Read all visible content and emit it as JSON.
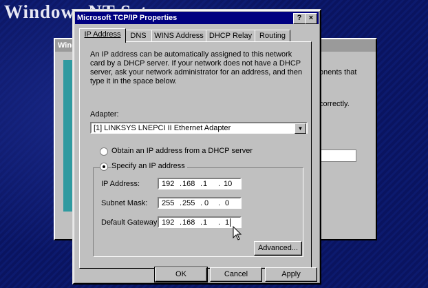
{
  "desktop": {
    "setup_title": "Windows NT Setup"
  },
  "background_window": {
    "title": "Windo",
    "text_components": "onents that",
    "text_correctly": "correctly."
  },
  "dialog": {
    "title": "Microsoft TCP/IP Properties",
    "help_button": "?",
    "close_button": "×",
    "tabs": [
      {
        "label": "IP Address",
        "active": true
      },
      {
        "label": "DNS",
        "active": false
      },
      {
        "label": "WINS Address",
        "active": false
      },
      {
        "label": "DHCP Relay",
        "active": false
      },
      {
        "label": "Routing",
        "active": false
      }
    ],
    "intro_text": "An IP address can be automatically assigned to this network card by a DHCP server.  If your network does not have a DHCP server, ask your network administrator for an address, and then type it in the space below.",
    "adapter_label": "Adapter:",
    "adapter_value": "[1] LINKSYS LNEPCI II Ethernet Adapter",
    "radio_dhcp": {
      "label": "Obtain an IP address from a DHCP server",
      "selected": false
    },
    "radio_specify": {
      "label": "Specify an IP address",
      "selected": true
    },
    "ip_address": {
      "label": "IP Address:",
      "octets": [
        "192",
        "168",
        "1",
        "10"
      ]
    },
    "subnet_mask": {
      "label": "Subnet Mask:",
      "octets": [
        "255",
        "255",
        "0",
        "0"
      ]
    },
    "default_gateway": {
      "label": "Default Gateway:",
      "octets": [
        "192",
        "168",
        "1",
        "1"
      ]
    },
    "advanced_button": "Advanced...",
    "ok_button": "OK",
    "cancel_button": "Cancel",
    "apply_button": "Apply"
  }
}
